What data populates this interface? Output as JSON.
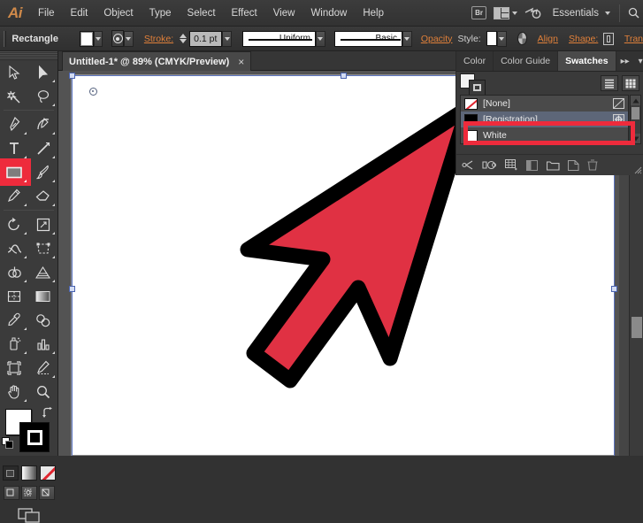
{
  "app": {
    "name": "Adobe Illustrator",
    "logo_text": "Ai"
  },
  "menubar": {
    "items": [
      {
        "label": "File"
      },
      {
        "label": "Edit"
      },
      {
        "label": "Object"
      },
      {
        "label": "Type"
      },
      {
        "label": "Select"
      },
      {
        "label": "Effect"
      },
      {
        "label": "View"
      },
      {
        "label": "Window"
      },
      {
        "label": "Help"
      }
    ],
    "bridge_label": "Br",
    "workspace": "Essentials",
    "workspace_caret": "▾"
  },
  "controlbar": {
    "tool_label": "Rectangle",
    "fill_swatch_color": "#ffffff",
    "stroke_label": "Stroke:",
    "stroke_weight": "0.1 pt",
    "stroke_profile": "Uniform",
    "brush_definition": "Basic",
    "opacity_label": "Opacity",
    "style_label": "Style:",
    "style_swatch_color": "#ffffff",
    "align_label": "Align",
    "shape_label": "Shape:",
    "transform_label": "Tran"
  },
  "document": {
    "tab_title": "Untitled-1* @ 89% (CMYK/Preview)",
    "close_glyph": "×",
    "zoom": "89%",
    "color_mode": "CMYK/Preview",
    "artboard_color": "#ffffff"
  },
  "toolbar": {
    "tools": [
      {
        "name": "selection-tool",
        "label": "Selection"
      },
      {
        "name": "direct-selection-tool",
        "label": "Direct Selection"
      },
      {
        "name": "magic-wand-tool",
        "label": "Magic Wand"
      },
      {
        "name": "lasso-tool",
        "label": "Lasso"
      },
      {
        "name": "pen-tool",
        "label": "Pen"
      },
      {
        "name": "curvature-tool",
        "label": "Curvature"
      },
      {
        "name": "type-tool",
        "label": "Type"
      },
      {
        "name": "line-segment-tool",
        "label": "Line Segment"
      },
      {
        "name": "rectangle-tool",
        "label": "Rectangle",
        "selected": true
      },
      {
        "name": "paintbrush-tool",
        "label": "Paintbrush"
      },
      {
        "name": "pencil-tool",
        "label": "Pencil"
      },
      {
        "name": "eraser-tool",
        "label": "Eraser"
      },
      {
        "name": "rotate-tool",
        "label": "Rotate"
      },
      {
        "name": "scale-tool",
        "label": "Scale"
      },
      {
        "name": "width-tool",
        "label": "Width"
      },
      {
        "name": "free-transform-tool",
        "label": "Free Transform"
      },
      {
        "name": "shape-builder-tool",
        "label": "Shape Builder"
      },
      {
        "name": "perspective-grid-tool",
        "label": "Perspective Grid"
      },
      {
        "name": "mesh-tool",
        "label": "Mesh"
      },
      {
        "name": "gradient-tool",
        "label": "Gradient"
      },
      {
        "name": "eyedropper-tool",
        "label": "Eyedropper"
      },
      {
        "name": "blend-tool",
        "label": "Blend"
      },
      {
        "name": "symbol-sprayer-tool",
        "label": "Symbol Sprayer"
      },
      {
        "name": "column-graph-tool",
        "label": "Column Graph"
      },
      {
        "name": "artboard-tool",
        "label": "Artboard"
      },
      {
        "name": "slice-tool",
        "label": "Slice"
      },
      {
        "name": "hand-tool",
        "label": "Hand"
      },
      {
        "name": "zoom-tool",
        "label": "Zoom"
      }
    ],
    "fill_color": "#ffffff",
    "stroke_color": "#000000",
    "selection_highlight_color": "#ee2b3c",
    "mode_buttons": [
      {
        "name": "color-mode-button",
        "label": "Color"
      },
      {
        "name": "gradient-mode-button",
        "label": "Gradient"
      },
      {
        "name": "none-mode-button",
        "label": "None"
      }
    ],
    "draw_buttons": [
      {
        "name": "draw-normal-button",
        "label": "Draw Normal"
      },
      {
        "name": "draw-behind-button",
        "label": "Draw Behind"
      },
      {
        "name": "draw-inside-button",
        "label": "Draw Inside"
      }
    ],
    "screen_mode_label": "Change Screen Mode"
  },
  "panel": {
    "tabs": [
      {
        "label": "Color",
        "active": false
      },
      {
        "label": "Color Guide",
        "active": false
      },
      {
        "label": "Swatches",
        "active": true
      }
    ],
    "expand_glyph": "▸▸",
    "menu_glyph": "▾≡",
    "swatches": [
      {
        "label": "[None]",
        "chip": "none",
        "selected": false,
        "end_icon": "none-marker"
      },
      {
        "label": "[Registration]",
        "chip": "registration",
        "selected": true,
        "end_icon": "registration-marker"
      },
      {
        "label": "White",
        "chip": "white",
        "selected": false,
        "end_icon": ""
      }
    ],
    "view_buttons": [
      {
        "name": "list-view-button",
        "label": "List View"
      },
      {
        "name": "grid-view-button",
        "label": "Grid View"
      }
    ],
    "bottom_tools": [
      {
        "name": "swatch-libraries-menu-icon",
        "label": "Swatch Libraries menu"
      },
      {
        "name": "color-group-link-icon",
        "label": "Show Swatch Kinds menu"
      },
      {
        "name": "swatch-options-icon",
        "label": "Swatch Options"
      },
      {
        "name": "new-color-group-icon",
        "label": "New Color Group"
      },
      {
        "name": "new-swatch-icon",
        "label": "New Swatch"
      },
      {
        "name": "delete-swatch-icon",
        "label": "Delete Swatch"
      }
    ]
  },
  "annotation": {
    "highlight_color": "#ee2b3c",
    "target_label": "[Registration]"
  },
  "pointer": {
    "name": "arrow-cursor-overlay",
    "fill_color": "#e03143",
    "outline_color": "#000000"
  }
}
